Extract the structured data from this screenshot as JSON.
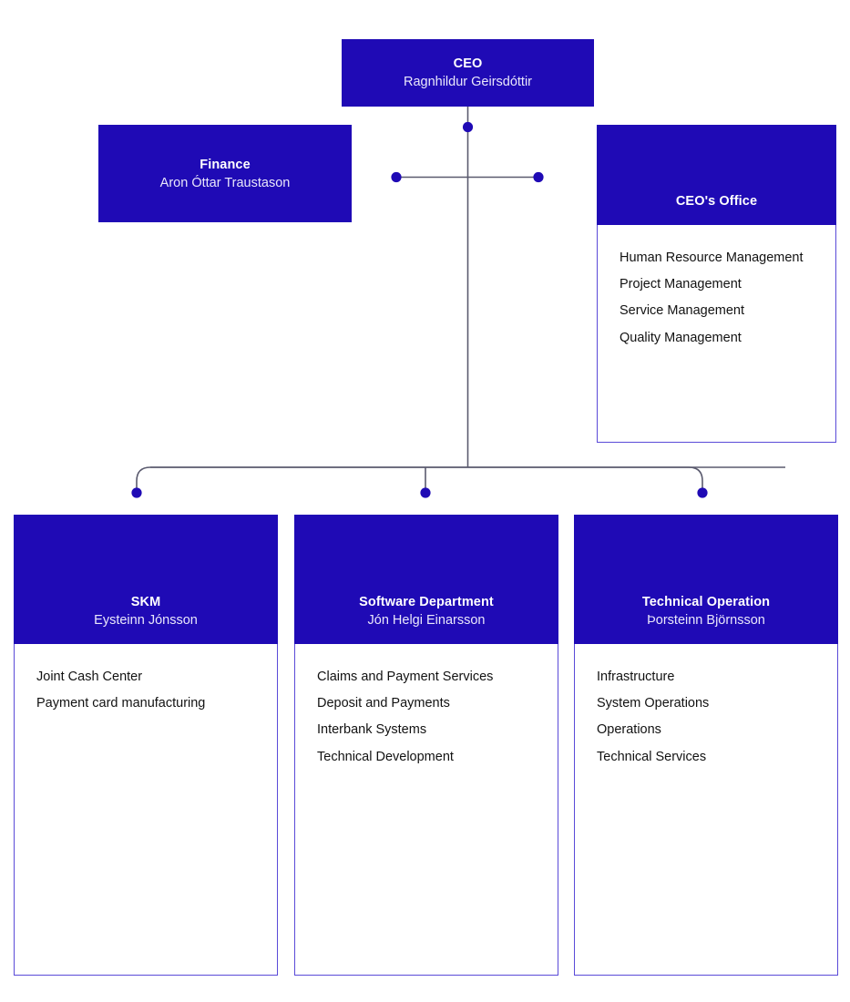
{
  "colors": {
    "header_blue": "#1f0ab5",
    "border_violet": "#5a4ad8",
    "connector_line": "#5a5a6e",
    "dot_blue": "#1f0ab5",
    "body_background": "#ffffff",
    "header_text": "#ffffff",
    "item_text": "#121212"
  },
  "nodes": {
    "ceo": {
      "title": "CEO",
      "person": "Ragnhildur Geirsdóttir",
      "items": []
    },
    "finance": {
      "title": "Finance",
      "person": "Aron Óttar Traustason",
      "items": []
    },
    "ceo_office": {
      "title": "CEO's Office",
      "person": "",
      "items": [
        "Human Resource Management",
        "Project Management",
        "Service Management",
        "Quality Management"
      ]
    },
    "skm": {
      "title": "SKM",
      "person": "Eysteinn Jónsson",
      "items": [
        "Joint Cash Center",
        "Payment card manufacturing"
      ]
    },
    "software": {
      "title": "Software Department",
      "person": "Jón Helgi Einarsson",
      "items": [
        "Claims and Payment Services",
        "Deposit and Payments",
        "Interbank Systems",
        "Technical Development"
      ]
    },
    "technical_operation": {
      "title": "Technical Operation",
      "person": "Þorsteinn Björnsson",
      "items": [
        "Infrastructure",
        "System Operations",
        "Operations",
        "Technical Services"
      ]
    }
  }
}
